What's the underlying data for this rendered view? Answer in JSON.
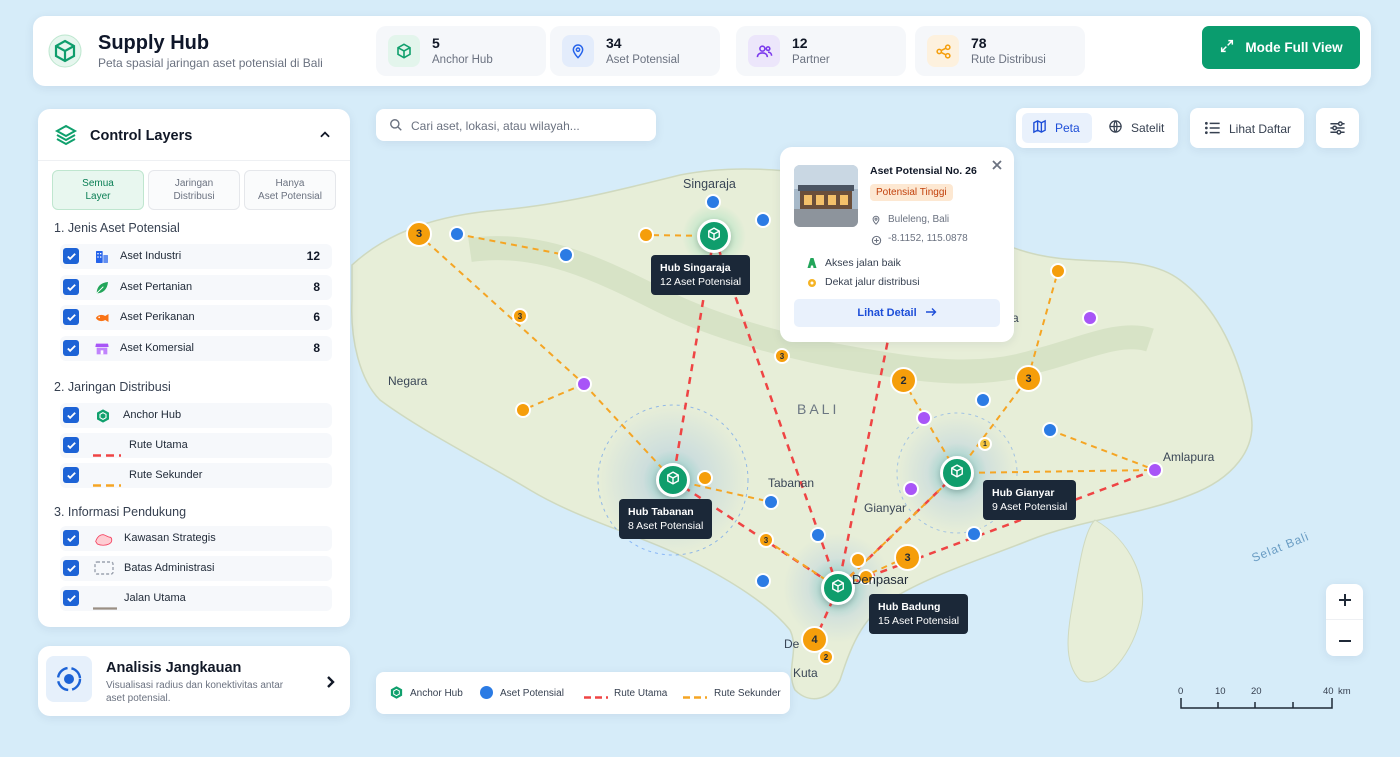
{
  "header": {
    "title": "Supply Hub",
    "subtitle": "Peta spasial jaringan aset potensial di Bali",
    "stats": [
      {
        "value": "5",
        "label": "Anchor Hub",
        "color": "#10a06d",
        "bg": "#e3f5ec",
        "icon": "cube-icon"
      },
      {
        "value": "34",
        "label": "Aset Potensial",
        "color": "#2563eb",
        "bg": "#e3ecfb",
        "icon": "location-pin-icon"
      },
      {
        "value": "12",
        "label": "Partner",
        "color": "#7c3aed",
        "bg": "#ece6fb",
        "icon": "users-icon"
      },
      {
        "value": "78",
        "label": "Rute Distribusi",
        "color": "#f59e0b",
        "bg": "#fdf1de",
        "icon": "share-nodes-icon"
      }
    ],
    "fullview_label": "Mode Full View"
  },
  "layers": {
    "title": "Control Layers",
    "tabs": [
      {
        "line1": "Semua",
        "line2": "Layer",
        "active": true
      },
      {
        "line1": "Jaringan",
        "line2": "Distribusi",
        "active": false
      },
      {
        "line1": "Hanya",
        "line2": "Aset Potensial",
        "active": false
      }
    ],
    "section1": "1. Jenis Aset Potensial",
    "assets": [
      {
        "label": "Aset Industri",
        "count": "12"
      },
      {
        "label": "Aset Pertanian",
        "count": "8"
      },
      {
        "label": "Aset Perikanan",
        "count": "6"
      },
      {
        "label": "Aset Komersial",
        "count": "8"
      }
    ],
    "section2": "2. Jaringan Distribusi",
    "network": [
      {
        "label": "Anchor Hub"
      },
      {
        "label": "Rute Utama"
      },
      {
        "label": "Rute Sekunder"
      }
    ],
    "section3": "3. Informasi Pendukung",
    "support": [
      {
        "label": "Kawasan Strategis"
      },
      {
        "label": "Batas Administrasi"
      },
      {
        "label": "Jalan Utama"
      }
    ]
  },
  "analysis": {
    "title": "Analisis Jangkauan",
    "subtitle": "Visualisasi radius dan konektivitas antar aset potensial."
  },
  "search": {
    "placeholder": "Cari aset, lokasi, atau wilayah..."
  },
  "view": {
    "map_label": "Peta",
    "satellite_label": "Satelit",
    "active": "Peta",
    "list_label": "Lihat Daftar"
  },
  "popup": {
    "title": "Aset Potensial No. 26",
    "badge": "Potensial Tinggi",
    "location": "Buleleng, Bali",
    "coords": "-8.1152, 115.0878",
    "features": [
      "Akses jalan baik",
      "Dekat jalur distribusi"
    ],
    "button": "Lihat Detail"
  },
  "hubs": [
    {
      "name": "Hub Singaraja",
      "assets": "12 Aset Potensial"
    },
    {
      "name": "Hub Tabanan",
      "assets": "8 Aset Potensial"
    },
    {
      "name": "Hub Gianyar",
      "assets": "9 Aset Potensial"
    },
    {
      "name": "Hub Badung",
      "assets": "15 Aset Potensial"
    }
  ],
  "places": {
    "singaraja": "Singaraja",
    "negara": "Negara",
    "bali": "BALI",
    "tabanan": "Tabanan",
    "gianyar": "Gianyar",
    "amlapura": "Amlapura",
    "denpasar": "Denpasar",
    "kuta": "Kuta",
    "selat": "Selat Bali",
    "de": "De",
    "a": "a"
  },
  "clusters": [
    "3",
    "3",
    "3",
    "2",
    "3",
    "1",
    "3",
    "3",
    "4",
    "2"
  ],
  "legend": {
    "hub": "Anchor Hub",
    "asset": "Aset Potensial",
    "main": "Rute Utama",
    "secondary": "Rute Sekunder"
  },
  "scale": {
    "t0": "0",
    "t1": "10",
    "t2": "20",
    "t3": "40",
    "unit": "km"
  },
  "colors": {
    "primary": "#0a9c6e",
    "hub": "#10a06d",
    "asset": "#2b7be4",
    "partner": "#a855f7",
    "cluster": "#f59e0b",
    "main_route": "#ef4444",
    "secondary_route": "#f5a524"
  }
}
